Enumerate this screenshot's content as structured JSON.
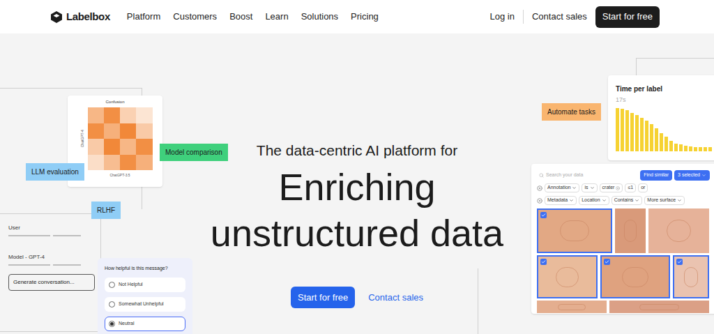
{
  "nav": {
    "logo": "Labelbox",
    "links": [
      "Platform",
      "Customers",
      "Boost",
      "Learn",
      "Solutions",
      "Pricing"
    ],
    "login": "Log in",
    "contact": "Contact sales",
    "cta": "Start for free"
  },
  "hero": {
    "eyebrow": "The data-centric AI platform for",
    "headline": [
      "Enriching",
      "unstructured data"
    ],
    "buttons": [
      {
        "label": "Start for free",
        "kind": "primary"
      },
      {
        "label": "Contact sales",
        "kind": "link"
      }
    ]
  },
  "tags": [
    {
      "label": "Model comparison",
      "color": "#3fd07c"
    },
    {
      "label": "LLM evaluation",
      "color": "#8fcdf6"
    },
    {
      "label": "RLHF",
      "color": "#8fcdf6"
    },
    {
      "label": "Automate tasks",
      "color": "#f9b56f"
    }
  ],
  "confusion_chart": {
    "title": "Confusion",
    "y_label": "ChatGPT-4",
    "x_label": "ChatGPT-3.5",
    "cells": [
      [
        0.55,
        0.85,
        0.35,
        0.2
      ],
      [
        0.85,
        0.6,
        0.9,
        0.4
      ],
      [
        0.4,
        0.9,
        0.55,
        0.85
      ],
      [
        0.25,
        0.5,
        0.85,
        0.6
      ]
    ]
  },
  "conversation": {
    "rows": [
      "User",
      "Model - GPT-4"
    ],
    "button": "Generate conversation..."
  },
  "survey": {
    "question": "How helpful is this message?",
    "options": [
      {
        "label": "Not Helpful",
        "selected": false
      },
      {
        "label": "Somewhat Unhelpful",
        "selected": false
      },
      {
        "label": "Neutral",
        "selected": true
      }
    ]
  },
  "time_chart": {
    "title": "Time per label",
    "value": "17s",
    "values": [
      17,
      16.5,
      16,
      15,
      14,
      13,
      12,
      10.5,
      9,
      7,
      5.5,
      4,
      3,
      2.5,
      2,
      1.8,
      1.6,
      1.5,
      1.5,
      1.4
    ]
  },
  "search_panel": {
    "placeholder": "Search your data",
    "find_button": "Find similar",
    "selected_button": "3 selected",
    "filters": [
      [
        {
          "label": "Annotation",
          "kind": "dropdown"
        },
        {
          "label": "is",
          "kind": "dropdown"
        },
        {
          "label": "crater",
          "kind": "chip"
        },
        {
          "label": "≤1",
          "kind": "text"
        },
        {
          "label": "or",
          "kind": "text"
        }
      ],
      [
        {
          "label": "Metadata",
          "kind": "dropdown"
        },
        {
          "label": "Location",
          "kind": "dropdown"
        },
        {
          "label": "Contains",
          "kind": "dropdown"
        },
        {
          "label": "More surface",
          "kind": "dropdown"
        }
      ]
    ],
    "images": [
      {
        "selected": true
      },
      {
        "selected": false
      },
      {
        "selected": false
      },
      {
        "selected": true
      },
      {
        "selected": true
      },
      {
        "selected": true
      },
      {
        "selected": false
      },
      {
        "selected": false
      }
    ]
  }
}
